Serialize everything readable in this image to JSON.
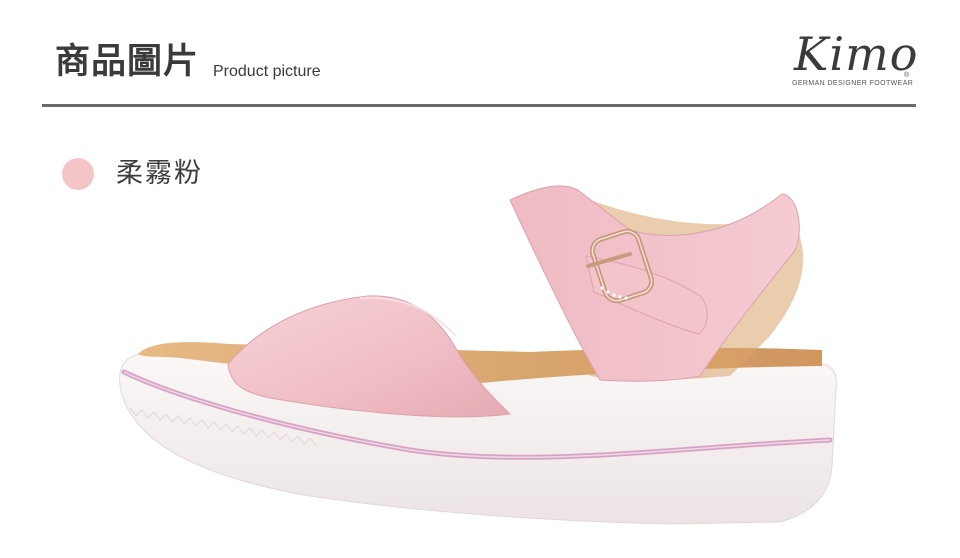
{
  "header": {
    "title_zh": "商品圖片",
    "title_en": "Product picture"
  },
  "brand": {
    "name": "Kimo",
    "registered": "®",
    "tagline": "GERMAN DESIGNER FOOTWEAR"
  },
  "color_option": {
    "name": "柔霧粉",
    "swatch": "#f4c5c6"
  },
  "product_image": {
    "subject": "pink wedge sandal with ankle strap and rhinestone buckle",
    "colors": {
      "upper": "#f2c2c8",
      "sole": "#f7f2f2",
      "stripe": "#d7a3c4",
      "footbed": "#d9a36b"
    }
  }
}
